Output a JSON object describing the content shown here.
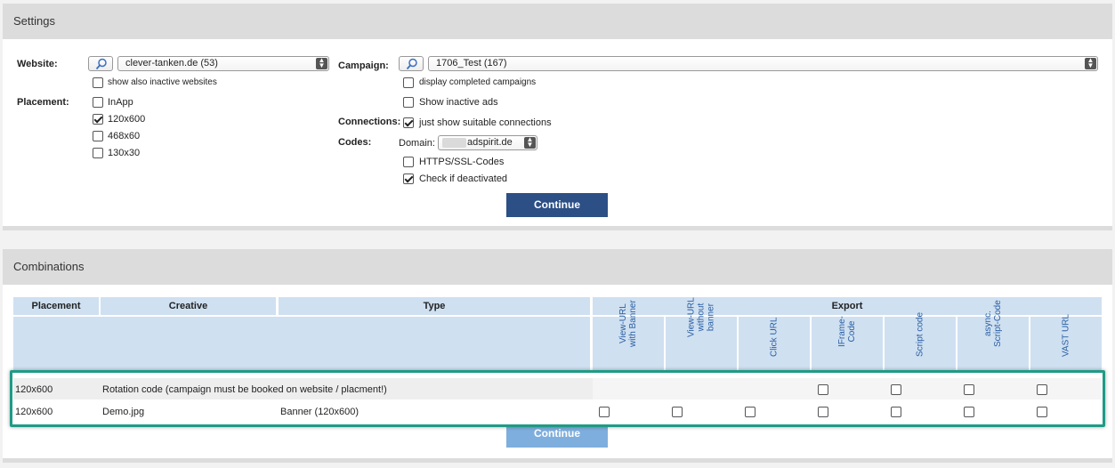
{
  "settings": {
    "title": "Settings",
    "website_label": "Website:",
    "website_value": "clever-tanken.de (53)",
    "show_inactive_websites": {
      "label": "show also inactive websites",
      "checked": false
    },
    "placement_label": "Placement:",
    "placements": [
      {
        "label": "InApp",
        "checked": false
      },
      {
        "label": "120x600",
        "checked": true
      },
      {
        "label": "468x60",
        "checked": false
      },
      {
        "label": "130x30",
        "checked": false
      }
    ],
    "campaign_label": "Campaign:",
    "campaign_value": "1706_Test (167)",
    "display_completed": {
      "label": "display completed campaigns",
      "checked": false
    },
    "show_inactive_ads": {
      "label": "Show inactive ads",
      "checked": false
    },
    "connections_label": "Connections:",
    "suitable_connections": {
      "label": "just show suitable connections",
      "checked": true
    },
    "codes_label": "Codes:",
    "domain_label": "Domain:",
    "domain_value": "adspirit.de",
    "https_codes": {
      "label": "HTTPS/SSL-Codes",
      "checked": false
    },
    "check_deactivated": {
      "label": "Check if deactivated",
      "checked": true
    },
    "continue_label": "Continue"
  },
  "combinations": {
    "title": "Combinations",
    "headers": {
      "placement": "Placement",
      "creative": "Creative",
      "type": "Type",
      "export": "Export"
    },
    "export_columns": [
      [
        "View-URL",
        "with Banner"
      ],
      [
        "View-URL",
        "without",
        "banner"
      ],
      [
        "Click URL"
      ],
      [
        "IFrame-",
        "Code"
      ],
      [
        "Script code"
      ],
      [
        "async.",
        "Script-Code"
      ],
      [
        "VAST URL"
      ]
    ],
    "rows": [
      {
        "placement": "120x600",
        "creative": "Rotation code (campaign must be booked on website / placment!)",
        "type": ""
      },
      {
        "placement": "120x600",
        "creative": "Demo.jpg",
        "type": "Banner (120x600)"
      }
    ],
    "continue_label": "Continue"
  },
  "colors": {
    "accent_button": "#2c4f86",
    "header_blue": "#cfe0f1",
    "highlight_border": "#1f9a86"
  }
}
